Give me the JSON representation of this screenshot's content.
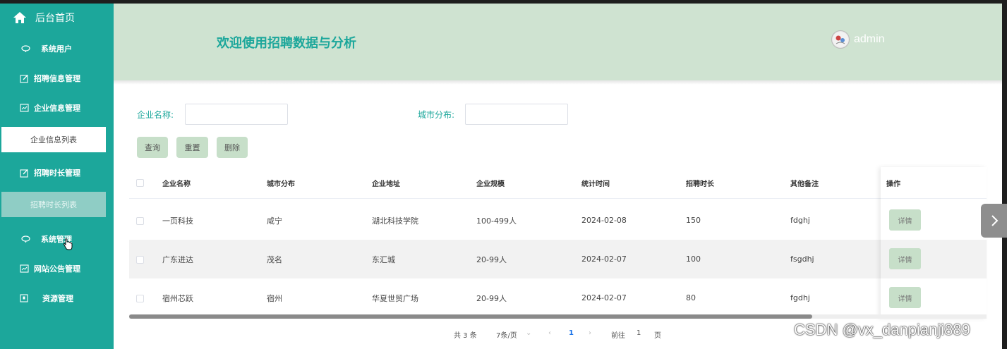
{
  "sidebar": {
    "home_label": "后台首页",
    "items": [
      {
        "label": "系统用户",
        "icon": "balloon-icon"
      },
      {
        "label": "招聘信息管理",
        "icon": "edit-icon"
      },
      {
        "label": "企业信息管理",
        "icon": "chart-icon"
      },
      {
        "label": "企业信息列表",
        "type": "sub-active"
      },
      {
        "label": "招聘时长管理",
        "icon": "edit-icon"
      },
      {
        "label": "招聘时长列表",
        "type": "sub-hover"
      },
      {
        "label": "系统管理",
        "icon": "balloon-icon"
      },
      {
        "label": "网站公告管理",
        "icon": "chart-icon"
      },
      {
        "label": "资源管理",
        "icon": "resource-icon"
      }
    ]
  },
  "header": {
    "title": "欢迎使用招聘数据与分析",
    "username": "admin"
  },
  "search": {
    "company_label": "企业名称:",
    "city_label": "城市分布:",
    "company_value": "",
    "city_value": "",
    "query_btn": "查询",
    "reset_btn": "重置",
    "delete_btn": "删除"
  },
  "table": {
    "headers": [
      "企业名称",
      "城市分布",
      "企业地址",
      "企业规模",
      "统计时间",
      "招聘时长",
      "其他备注",
      "操作"
    ],
    "rows": [
      [
        "一页科技",
        "咸宁",
        "湖北科技学院",
        "100-499人",
        "2024-02-08",
        "150",
        "fdghj"
      ],
      [
        "广东进达",
        "茂名",
        "东汇城",
        "20-99人",
        "2024-02-07",
        "100",
        "fsgdhj"
      ],
      [
        "宿州芯跃",
        "宿州",
        "华夏世贸广场",
        "20-99人",
        "2024-02-07",
        "80",
        "fgdhj"
      ]
    ],
    "detail_label": "详情"
  },
  "pagination": {
    "total": "共 3 条",
    "page_size": "7条/页",
    "current_page": "1",
    "goto_label": "前往",
    "goto_value": "1",
    "page_unit": "页"
  },
  "watermark": "CSDN @vx_danpianji889"
}
